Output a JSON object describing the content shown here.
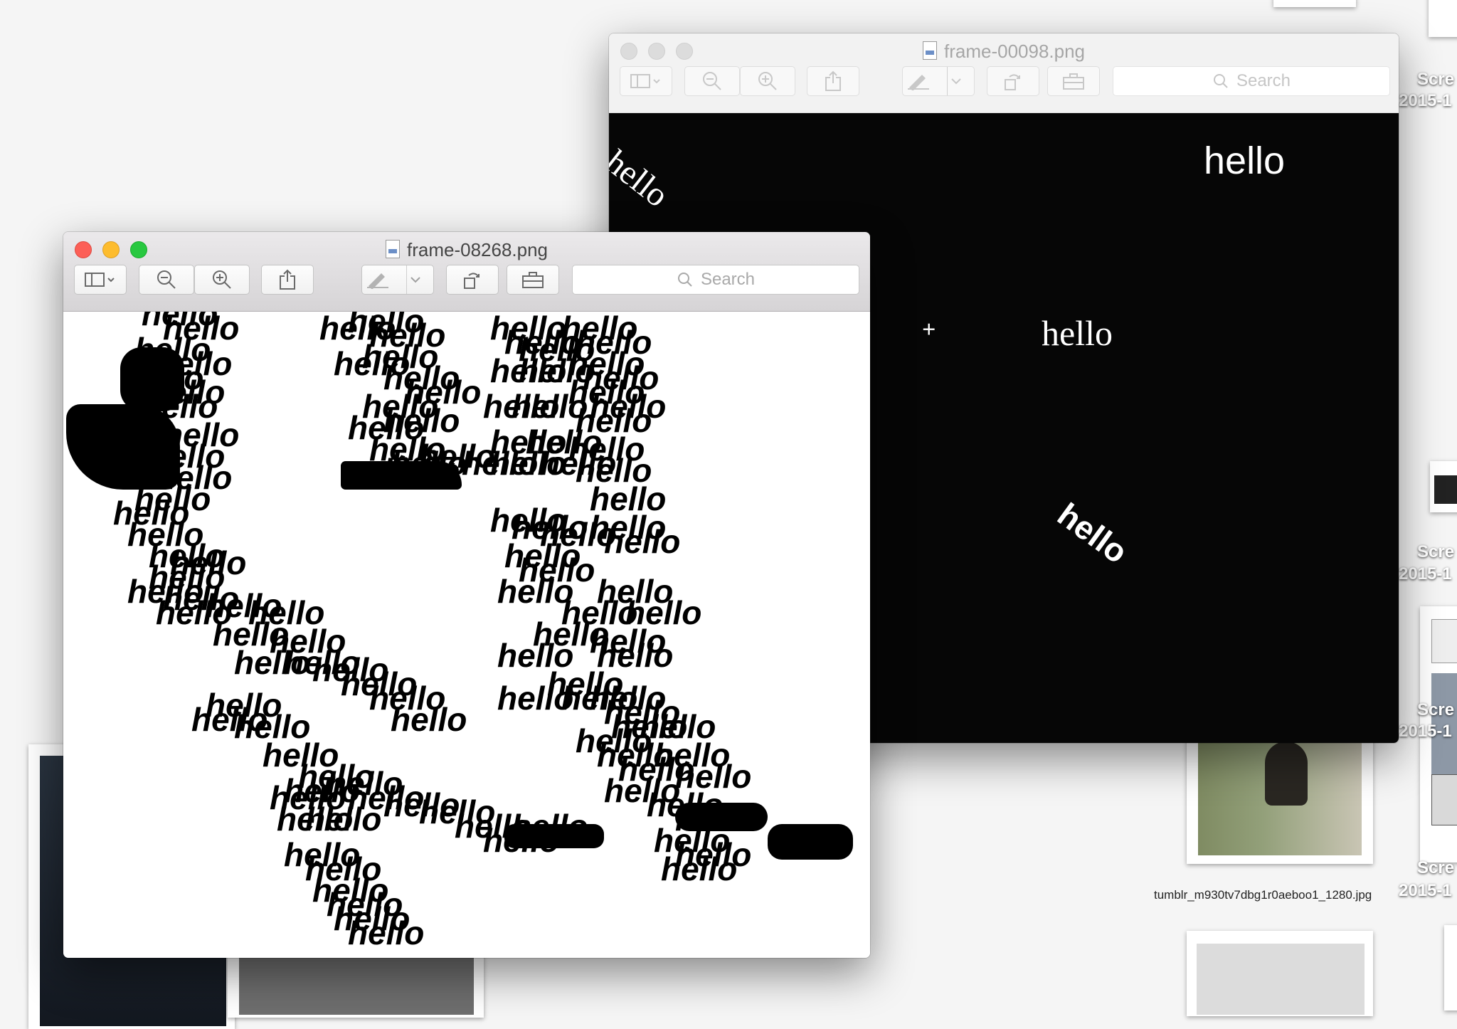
{
  "background_window": {
    "title": "frame-00098.png",
    "search_placeholder": "Search",
    "canvas_words": [
      "hello",
      "hello",
      "hello",
      "hello"
    ],
    "crosshair": "+"
  },
  "front_window": {
    "title": "frame-08268.png",
    "search_placeholder": "Search",
    "word": "hello"
  },
  "desktop": {
    "icon_labels": [
      "Scre",
      "Scre",
      "Scre",
      "Scre"
    ],
    "icon_sublabels": [
      "2015-1",
      "2015-1",
      "2015-1",
      "2015-1"
    ],
    "file_caption": "tumblr_m930tv7dbg1r0aeboo1_1280.jpg"
  }
}
